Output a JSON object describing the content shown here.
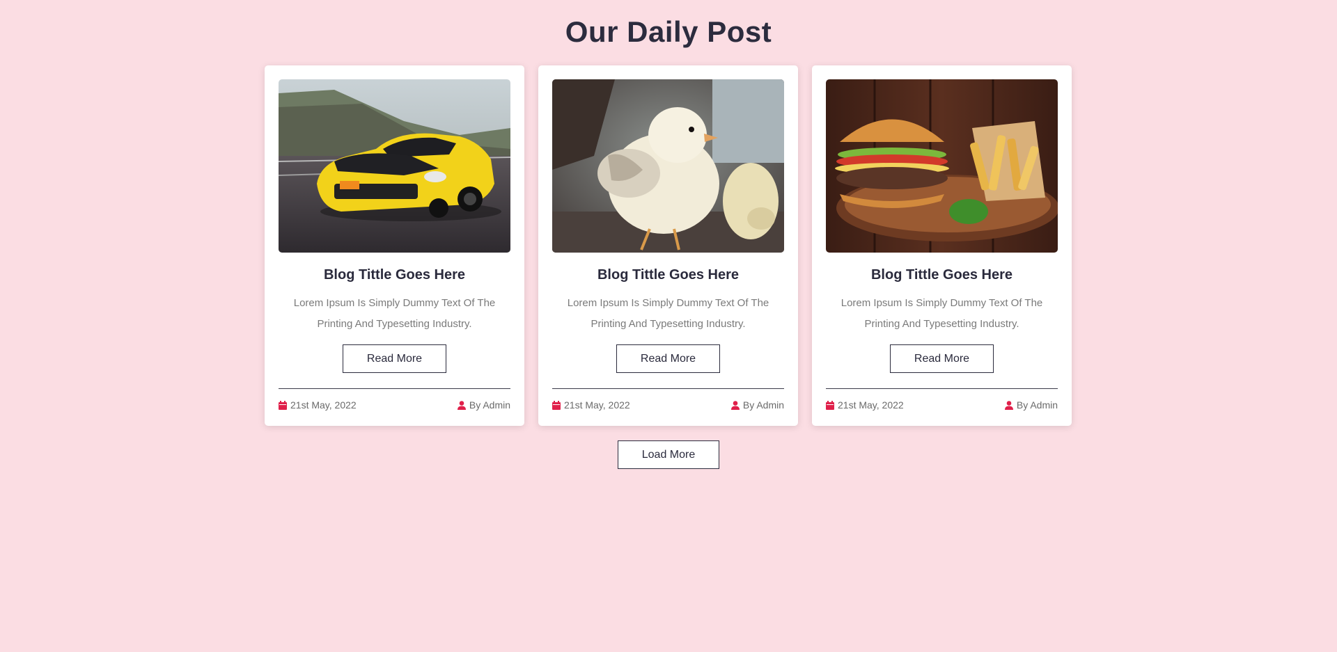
{
  "page": {
    "heading": "Our Daily Post"
  },
  "posts": [
    {
      "image": "yellow-sports-car",
      "title": "Blog Tittle Goes Here",
      "text": "Lorem Ipsum Is Simply Dummy Text Of The Printing And Typesetting Industry.",
      "button": "Read More",
      "date": "21st May, 2022",
      "author": "By Admin"
    },
    {
      "image": "baby-chicks",
      "title": "Blog Tittle Goes Here",
      "text": "Lorem Ipsum Is Simply Dummy Text Of The Printing And Typesetting Industry.",
      "button": "Read More",
      "date": "21st May, 2022",
      "author": "By Admin"
    },
    {
      "image": "burger-and-fries",
      "title": "Blog Tittle Goes Here",
      "text": "Lorem Ipsum Is Simply Dummy Text Of The Printing And Typesetting Industry.",
      "button": "Read More",
      "date": "21st May, 2022",
      "author": "By Admin"
    }
  ],
  "load_more": "Load More",
  "icons": {
    "date": "calendar-icon",
    "author": "user-icon"
  },
  "colors": {
    "background": "#fbdde3",
    "accent": "#e0204a",
    "heading": "#2c2c3e"
  }
}
